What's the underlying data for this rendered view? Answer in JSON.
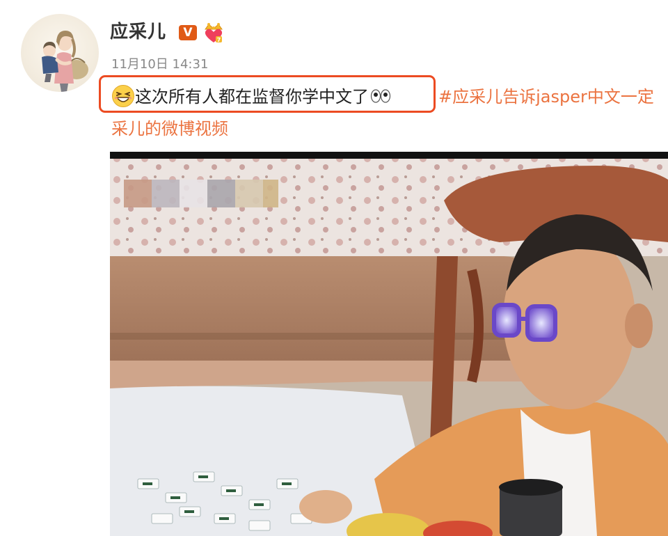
{
  "post": {
    "author": "应采儿",
    "verified_badge": "V",
    "timestamp": "11月10日 14:31",
    "text": "这次所有人都在监督你学中文了",
    "hashtag": "#应采儿告诉jasper中文一定",
    "source_link": "采儿的微博视频"
  },
  "icons": {
    "avatar": "avatar-illustration",
    "verified": "verified-v-badge",
    "crown": "crown-heart-badge",
    "emoji_grin": "grinning-squint-emoji",
    "emoji_eyes": "eyes-emoji"
  },
  "colors": {
    "link": "#eb7340",
    "highlight_border": "#ec4b22",
    "verified_badge_bg": "#e05a16",
    "timestamp": "#888888"
  }
}
